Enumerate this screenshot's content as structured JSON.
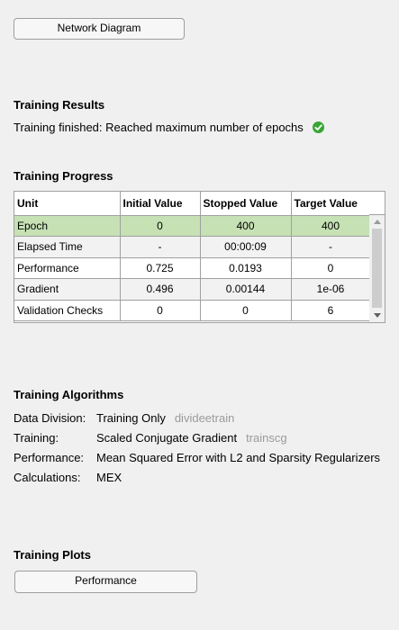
{
  "buttons": {
    "network_diagram": "Network Diagram",
    "performance": "Performance"
  },
  "results": {
    "title": "Training Results",
    "status": "Training finished: Reached maximum number of epochs",
    "status_icon": "check-circle-icon",
    "status_color": "#3aa534"
  },
  "progress": {
    "title": "Training Progress",
    "columns": [
      "Unit",
      "Initial Value",
      "Stopped Value",
      "Target Value"
    ],
    "rows": [
      [
        "Epoch",
        "0",
        "400",
        "400"
      ],
      [
        "Elapsed Time",
        "-",
        "00:00:09",
        "-"
      ],
      [
        "Performance",
        "0.725",
        "0.0193",
        "0"
      ],
      [
        "Gradient",
        "0.496",
        "0.00144",
        "1e-06"
      ],
      [
        "Validation Checks",
        "0",
        "0",
        "6"
      ]
    ],
    "selected_color": "#c6e1b4"
  },
  "algorithms": {
    "title": "Training Algorithms",
    "items": [
      {
        "label": "Data Division:",
        "value": "Training Only",
        "code": "divideetrain"
      },
      {
        "label": "Training:",
        "value": "Scaled Conjugate Gradient",
        "code": "trainscg"
      },
      {
        "label": "Performance:",
        "value": "Mean Squared Error with L2 and Sparsity Regularizers",
        "code": ""
      },
      {
        "label": "Calculations:",
        "value": "MEX",
        "code": ""
      }
    ]
  },
  "plots": {
    "title": "Training Plots"
  }
}
